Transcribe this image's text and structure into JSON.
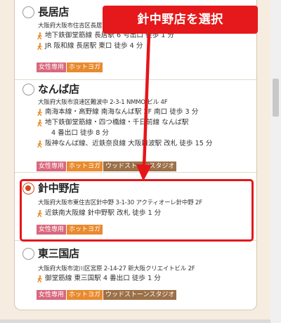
{
  "annotation": {
    "text": "針中野店を選択"
  },
  "stores": [
    {
      "name": "長居店",
      "address": "大阪府大阪市住吉区長居東",
      "access": [
        "地下鉄御堂筋線 長居駅 6 号出口 徒歩 1 分",
        "JR 阪和線 長居駅 東口 徒歩 4 分"
      ],
      "tags": [
        "女性専用",
        "ホットヨガ"
      ],
      "selected": false
    },
    {
      "name": "なんば店",
      "address": "大阪府大阪市浪速区難波中 2-3-1 NMMO ビル 4F",
      "access": [
        "南海本線・高野線 南海なんば駅 2F 南口 徒歩 3 分",
        "地下鉄御堂筋線・四つ橋線・千日前線 なんば駅",
        "4 番出口 徒歩 8 分",
        "阪神なんば線、近鉄奈良線 大阪難波駅 改札 徒歩 15 分"
      ],
      "tags": [
        "女性専用",
        "ホットヨガ",
        "ウッドストーンスタジオ"
      ],
      "selected": false
    },
    {
      "name": "針中野店",
      "address": "大阪府大阪市東住吉区針中野 3-1-30 アクティオーレ針中野 2F",
      "access": [
        "近鉄南大阪線 針中野駅 改札 徒歩 1 分"
      ],
      "tags": [
        "女性専用",
        "ホットヨガ"
      ],
      "selected": true
    },
    {
      "name": "東三国店",
      "address": "大阪府大阪市淀川区宮原 2-14-27 新大阪クリエイトビル 2F",
      "access": [
        "御堂筋線 東三国駅 4 番出口 徒歩 1 分"
      ],
      "tags": [
        "女性専用",
        "ホットヨガ",
        "ウッドストーンスタジオ"
      ],
      "selected": false
    }
  ],
  "colors": {
    "accent": "#d24a1c",
    "highlight": "#e5151a",
    "tag_women": "#d8687e",
    "tag_hotyoga": "#e88a2e",
    "tag_woodstone": "#9c7048"
  }
}
